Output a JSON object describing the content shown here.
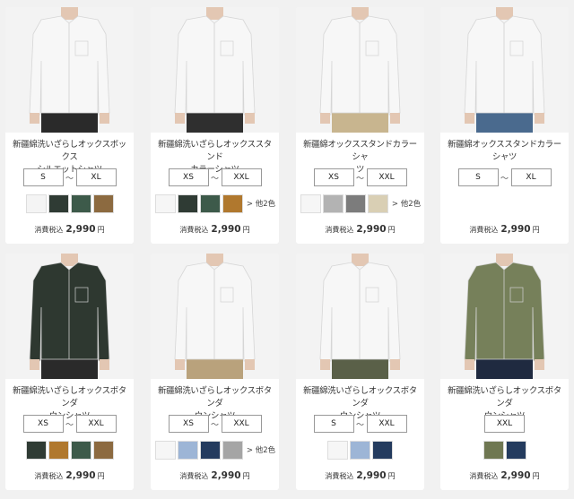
{
  "colors": {
    "page_bg": "#f1f1f1",
    "card_bg": "#ffffff",
    "white_shirt": "#f7f7f7",
    "dark_green_shirt": "#2e3830",
    "khaki_shirt": "#76805a"
  },
  "tilde": "～",
  "products": [
    {
      "name_line1": "新疆綿洗いざらしオックスボックス",
      "name_line2": "シルエットシャツ",
      "size_min": "S",
      "size_max": "XL",
      "swatches": [
        "#f4f4f4",
        "#2f3b34",
        "#3d5a4a",
        "#8c6a40"
      ],
      "more": "",
      "tax_label": "消費税込",
      "price": "2,990",
      "yen": "円",
      "shirt_color": "#f7f7f7",
      "pants_color": "#2a2a2a",
      "icon": "shirt-icon"
    },
    {
      "name_line1": "新疆綿洗いざらしオックススタンド",
      "name_line2": "カラーシャツ",
      "size_min": "XS",
      "size_max": "XXL",
      "swatches": [
        "#f6f6f6",
        "#2f3b34",
        "#3d5a4a",
        "#b0782e"
      ],
      "more": "> 他2色",
      "tax_label": "消費税込",
      "price": "2,990",
      "yen": "円",
      "shirt_color": "#f7f7f7",
      "pants_color": "#2f2f2f",
      "icon": "shirt-icon"
    },
    {
      "name_line1": "新疆綿オックススタンドカラーシャ",
      "name_line2": "ツ",
      "size_min": "XS",
      "size_max": "XXL",
      "swatches": [
        "#f6f6f6",
        "#b3b3b3",
        "#7c7c7c",
        "#d9cfb4"
      ],
      "more": "> 他2色",
      "tax_label": "消費税込",
      "price": "2,990",
      "yen": "円",
      "shirt_color": "#f7f7f7",
      "pants_color": "#c8b58f",
      "icon": "shirt-icon"
    },
    {
      "name_line1": "新疆綿オックススタンドカラーシャツ",
      "name_line2": "",
      "size_min": "S",
      "size_max": "XL",
      "swatches": [],
      "more": "",
      "tax_label": "消費税込",
      "price": "2,990",
      "yen": "円",
      "shirt_color": "#f7f7f7",
      "pants_color": "#4a6a8e",
      "icon": "shirt-icon"
    },
    {
      "name_line1": "新疆綿洗いざらしオックスボタンダ",
      "name_line2": "ウンシャツ",
      "size_min": "XS",
      "size_max": "XXL",
      "swatches": [
        "#2f3b34",
        "#b0782e",
        "#3d5a4a",
        "#8c6a40"
      ],
      "more": "",
      "tax_label": "消費税込",
      "price": "2,990",
      "yen": "円",
      "shirt_color": "#2e3830",
      "pants_color": "#2a2a2a",
      "icon": "shirt-icon"
    },
    {
      "name_line1": "新疆綿洗いざらしオックスボタンダ",
      "name_line2": "ウンシャツ",
      "size_min": "XS",
      "size_max": "XXL",
      "swatches": [
        "#f6f6f6",
        "#9db5d6",
        "#243b5e",
        "#a5a5a5"
      ],
      "more": "> 他2色",
      "tax_label": "消費税込",
      "price": "2,990",
      "yen": "円",
      "shirt_color": "#f7f7f7",
      "pants_color": "#b9a27c",
      "icon": "shirt-icon"
    },
    {
      "name_line1": "新疆綿洗いざらしオックスボタンダ",
      "name_line2": "ウンシャツ",
      "size_min": "S",
      "size_max": "XXL",
      "swatches": [
        "#f6f6f6",
        "#9db5d6",
        "#243b5e"
      ],
      "more": "",
      "tax_label": "消費税込",
      "price": "2,990",
      "yen": "円",
      "shirt_color": "#f7f7f7",
      "pants_color": "#5a6048",
      "icon": "shirt-icon"
    },
    {
      "name_line1": "新疆綿洗いざらしオックスボタンダ",
      "name_line2": "ウンシャツ",
      "size_min": "XXL",
      "size_max": "",
      "swatches": [
        "#6f7752",
        "#243b5e"
      ],
      "more": "",
      "tax_label": "消費税込",
      "price": "2,990",
      "yen": "円",
      "shirt_color": "#76805a",
      "pants_color": "#1f2a40",
      "icon": "shirt-icon"
    }
  ]
}
